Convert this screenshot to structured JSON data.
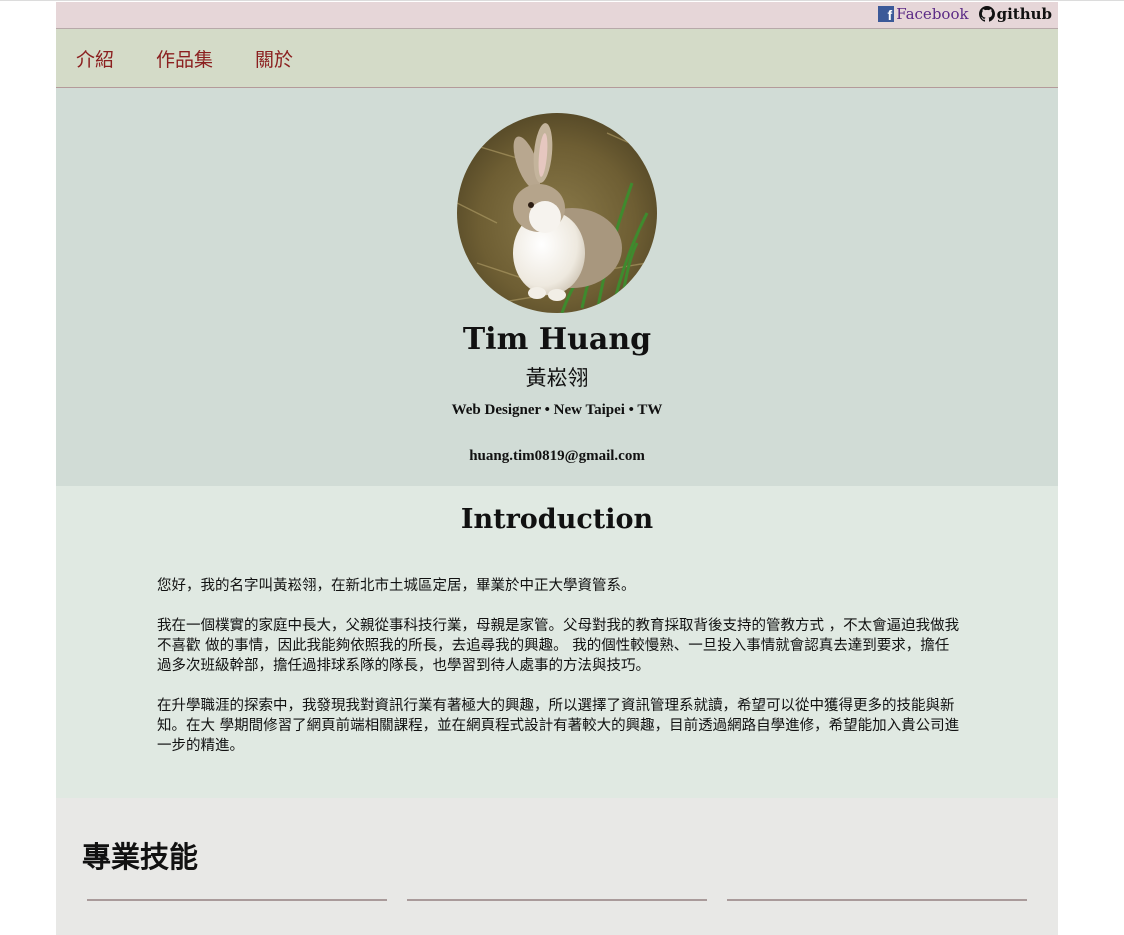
{
  "social": {
    "facebook_icon": "facebook-f-icon",
    "facebook_label": "Facebook",
    "github_icon": "github-octocat-icon",
    "github_label": "github"
  },
  "nav": {
    "items": [
      {
        "label": "介紹"
      },
      {
        "label": "作品集"
      },
      {
        "label": "關於"
      }
    ]
  },
  "profile": {
    "avatar": "rabbit-photo",
    "name": "Tim Huang",
    "name_zh": "黃崧翎",
    "tagline": "Web Designer • New Taipei • TW",
    "email": "huang.tim0819@gmail.com"
  },
  "intro": {
    "title": "Introduction",
    "paragraphs": [
      "您好，我的名字叫黃崧翎，在新北市土城區定居，畢業於中正大學資管系。",
      "我在一個樸實的家庭中長大，父親從事科技行業，母親是家管。父母對我的教育採取背後支持的管教方式 ，不太會逼迫我做我不喜歡 做的事情，因此我能夠依照我的所長，去追尋我的興趣。 我的個性較慢熟、一旦投入事情就會認真去達到要求，擔任過多次班級幹部，擔任過排球系隊的隊長，也學習到待人處事的方法與技巧。",
      "在升學職涯的探索中，我發現我對資訊行業有著極大的興趣，所以選擇了資訊管理系就讀，希望可以從中獲得更多的技能與新知。在大 學期間修習了網頁前端相關課程，並在網頁程式設計有著較大的興趣，目前透過網路自學進修，希望能加入貴公司進一步的精進。"
    ]
  },
  "skills": {
    "title": "專業技能"
  },
  "colors": {
    "social_bar": "#e6d6d8",
    "nav_bg": "#d4dbc8",
    "nav_text": "#8b1f1f",
    "hero_bg": "#d1dcd6",
    "intro_bg": "#e0e9e2",
    "skills_bg": "#e8e8e6",
    "facebook_blue": "#3b5998",
    "facebook_text": "#5b2a86"
  }
}
